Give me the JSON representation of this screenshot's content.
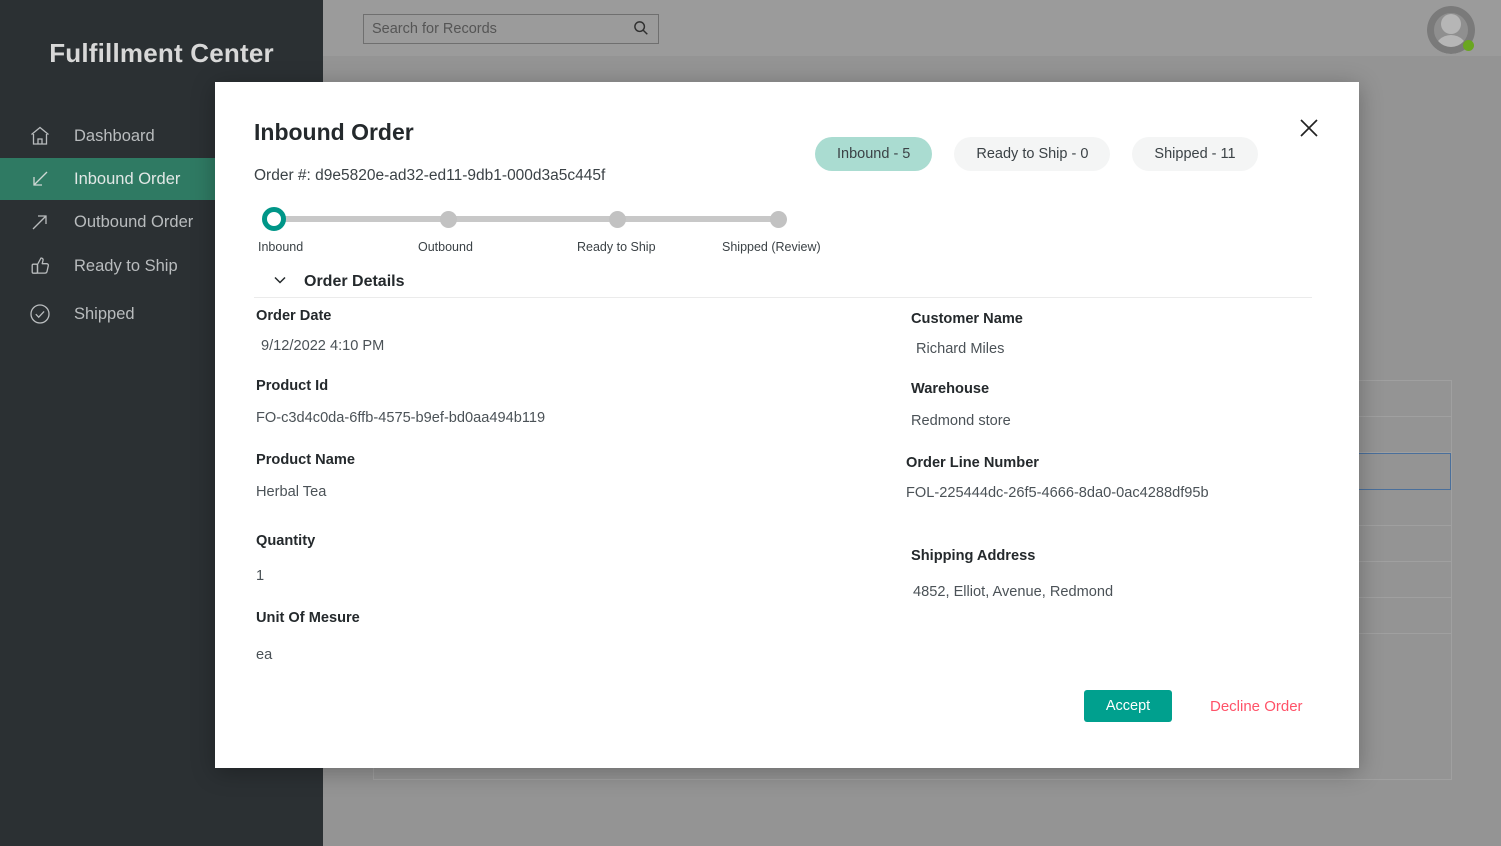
{
  "app": {
    "brand": "Fulfillment Center"
  },
  "sidebar": {
    "items": [
      {
        "label": "Dashboard",
        "icon": "home-icon",
        "active": false
      },
      {
        "label": "Inbound Order",
        "icon": "arrow-down-left-icon",
        "active": true
      },
      {
        "label": "Outbound Order",
        "icon": "arrow-up-right-icon",
        "active": false
      },
      {
        "label": "Ready to Ship",
        "icon": "thumbs-up-icon",
        "active": false
      },
      {
        "label": "Shipped",
        "icon": "check-circle-icon",
        "active": false
      }
    ]
  },
  "topbar": {
    "search": {
      "value": "",
      "placeholder": "Search for Records",
      "icon": "search-icon"
    },
    "avatar": {
      "icon": "avatar-icon",
      "presence": "online",
      "presence_color": "#6aa620"
    }
  },
  "modal": {
    "title": "Inbound Order",
    "order_number": "Order #: d9e5820e-ad32-ed11-9db1-000d3a5c445f",
    "close_icon": "close-icon",
    "pills": [
      {
        "label": "Inbound - 5",
        "active": true
      },
      {
        "label": "Ready to Ship - 0",
        "active": false
      },
      {
        "label": "Shipped - 11",
        "active": false
      }
    ],
    "stepper": {
      "steps": [
        {
          "label": "Inbound",
          "state": "current"
        },
        {
          "label": "Outbound",
          "state": "pending"
        },
        {
          "label": "Ready to Ship",
          "state": "pending"
        },
        {
          "label": "Shipped (Review)",
          "state": "pending"
        }
      ]
    },
    "section": {
      "label": "Order Details",
      "chevron_icon": "chevron-down-icon",
      "expanded": true
    },
    "fields_left": [
      {
        "label": "Order Date",
        "value": "9/12/2022 4:10 PM"
      },
      {
        "label": "Product Id",
        "value": "FO-c3d4c0da-6ffb-4575-b9ef-bd0aa494b119"
      },
      {
        "label": "Product Name",
        "value": "Herbal Tea"
      },
      {
        "label": "Quantity",
        "value": "1"
      },
      {
        "label": "Unit Of Mesure",
        "value": "ea"
      }
    ],
    "fields_right": [
      {
        "label": "Customer Name",
        "value": "Richard Miles"
      },
      {
        "label": "Warehouse",
        "value": "Redmond store"
      },
      {
        "label": "Order Line Number",
        "value": "FOL-225444dc-26f5-4666-8da0-0ac4288df95b"
      },
      {
        "label": "Shipping Address",
        "value": "4852, Elliot, Avenue, Redmond"
      }
    ],
    "accept_label": "Accept",
    "decline_label": "Decline Order"
  },
  "colors": {
    "accent_teal": "#009688",
    "accept_button": "#00a08e",
    "pill_active": "#aadcd1",
    "decline_text": "#ff5268",
    "sidebar_bg": "#2b3033",
    "sidebar_active": "#2f7a63",
    "scrim": "#949494",
    "row_selected_border": "#4a6f9b"
  }
}
